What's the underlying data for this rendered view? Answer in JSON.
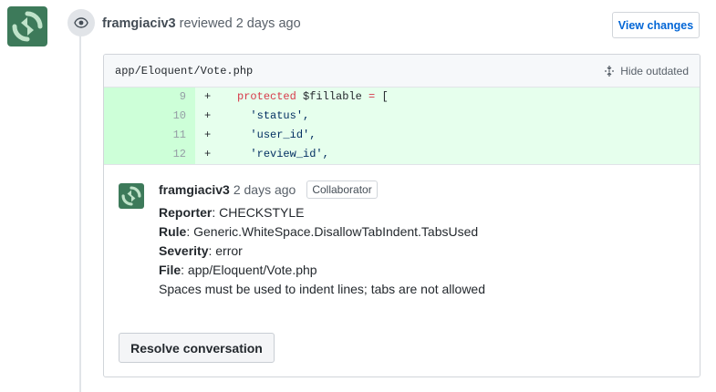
{
  "review": {
    "author": "framgiaciv3",
    "action_text": "reviewed 2 days ago",
    "view_changes_label": "View changes"
  },
  "file": {
    "path": "app/Eloquent/Vote.php",
    "hide_outdated_label": "Hide outdated"
  },
  "diff": {
    "lines": [
      {
        "num": "9",
        "sign": "+",
        "code": "    protected $fillable = ["
      },
      {
        "num": "10",
        "sign": "+",
        "code": "      'status',"
      },
      {
        "num": "11",
        "sign": "+",
        "code": "      'user_id',"
      },
      {
        "num": "12",
        "sign": "+",
        "code": "      'review_id',"
      }
    ]
  },
  "comment": {
    "author": "framgiaciv3",
    "time": "2 days ago",
    "role": "Collaborator",
    "reporter_label": "Reporter",
    "reporter_value": ": CHECKSTYLE",
    "rule_label": "Rule",
    "rule_value": ": Generic.WhiteSpace.DisallowTabIndent.TabsUsed",
    "severity_label": "Severity",
    "severity_value": ": error",
    "file_label": "File",
    "file_value": ": app/Eloquent/Vote.php",
    "message": "Spaces must be used to indent lines; tabs are not allowed"
  },
  "resolve_label": "Resolve conversation",
  "colors": {
    "avatar_bg": "#3d7a5a",
    "link": "#0366d6",
    "diff_add_bg": "#e6ffed",
    "diff_add_num_bg": "#cdffd8"
  },
  "icons": {
    "eye": "eye-icon",
    "unfold": "unfold-icon",
    "avatar": "identicon-avatar"
  }
}
